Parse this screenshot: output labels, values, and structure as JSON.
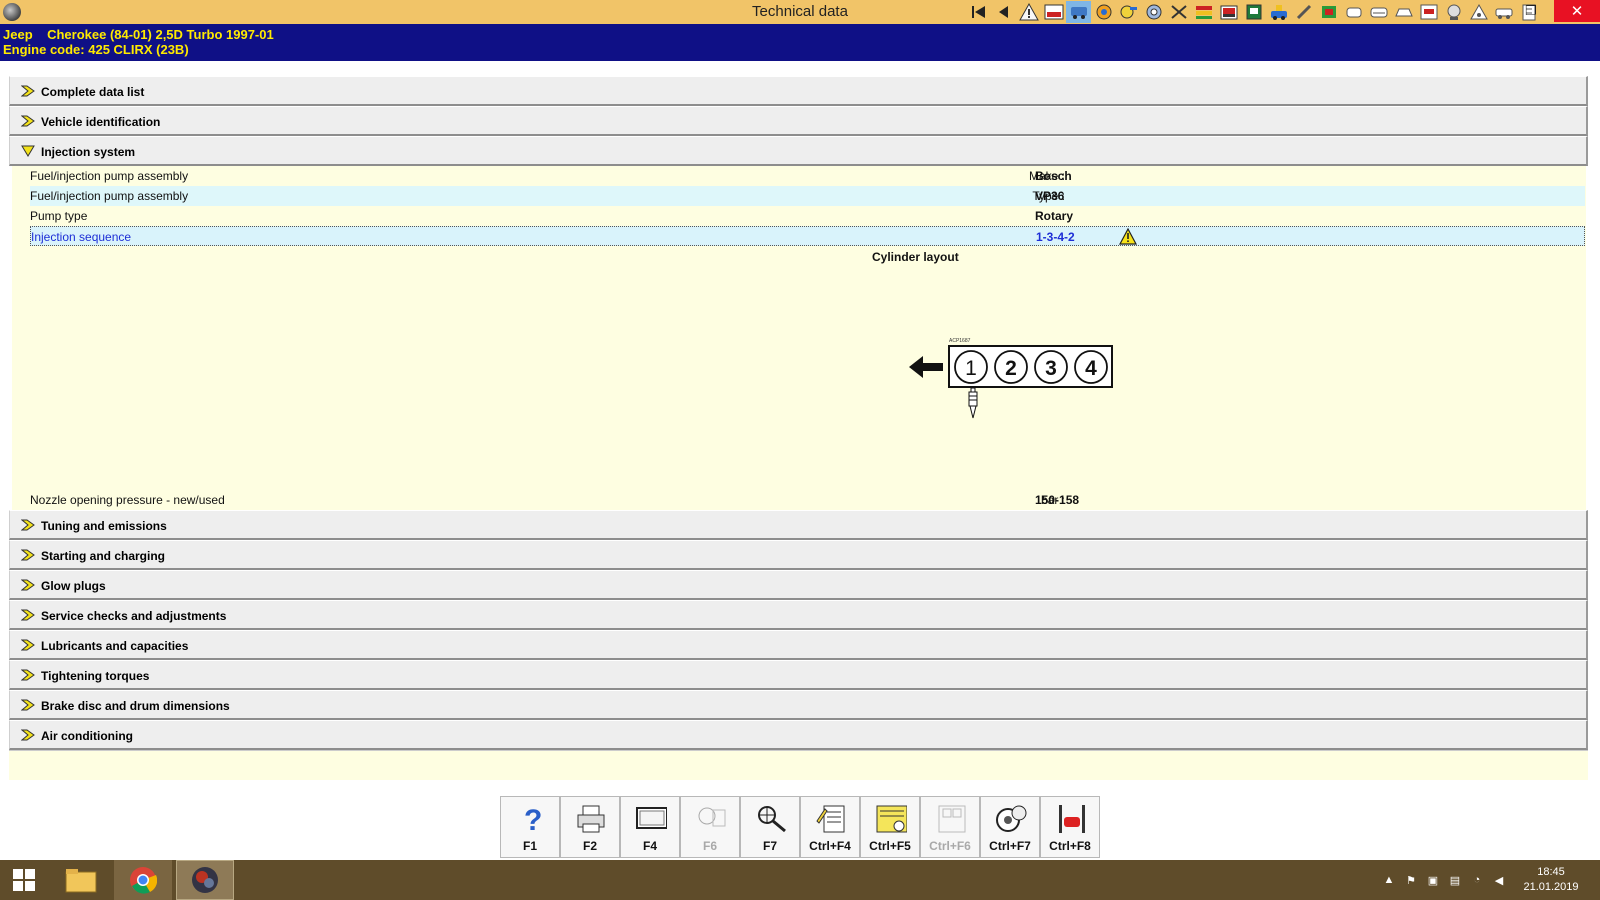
{
  "window": {
    "title": "Technical data",
    "restore_label": "❐",
    "close_label": "✕"
  },
  "toolbar": {
    "icons": [
      "first-page-icon",
      "back-icon",
      "warning-icon",
      "car-lift-icon",
      "car-color-icon",
      "engine-icon",
      "wrench-icon",
      "gauge-icon",
      "tools-icon",
      "battery-icon",
      "car-front-icon",
      "service-icon",
      "car-diagnose-icon",
      "chip-icon",
      "brake-icon",
      "tire-icon",
      "car-outline-icon",
      "spanner-icon",
      "lift-icon",
      "steering-icon",
      "triangle-icon",
      "car-side-icon",
      "clipboard-icon"
    ]
  },
  "vehicle": {
    "line1": "Jeep    Cherokee (84-01) 2,5D Turbo 1997-01",
    "line2": "Engine code: 425 CLIRX (23B)"
  },
  "sections": {
    "complete_data_list": "Complete data list",
    "vehicle_identification": "Vehicle identification",
    "injection_system": "Injection system",
    "tuning": "Tuning and emissions",
    "starting": "Starting and charging",
    "glow_plugs": "Glow plugs",
    "service_checks": "Service checks and adjustments",
    "lubricants": "Lubricants and capacities",
    "torques": "Tightening torques",
    "brake": "Brake disc and drum dimensions",
    "aircon": "Air conditioning"
  },
  "injection": {
    "rows": [
      {
        "name": "Fuel/injection pump assembly",
        "unit": "Make :",
        "value": "Bosch"
      },
      {
        "name": "Fuel/injection pump assembly",
        "unit": "Type :",
        "value": "VP36"
      },
      {
        "name": "Pump type",
        "unit": ":",
        "value": "Rotary"
      },
      {
        "name": "Injection sequence",
        "unit": ":",
        "value": "1-3-4-2"
      }
    ],
    "cylinder_layout_title": "Cylinder layout",
    "diagram_code": "ACP1687",
    "cylinders": [
      "1",
      "2",
      "3",
      "4"
    ],
    "nozzle": {
      "name": "Nozzle opening pressure - new/used",
      "unit": "bar :",
      "value": "150-158"
    }
  },
  "fkeys": [
    {
      "key": "F1",
      "icon": "help-icon",
      "enabled": true
    },
    {
      "key": "F2",
      "icon": "print-icon",
      "enabled": true
    },
    {
      "key": "F4",
      "icon": "monitor-icon",
      "enabled": true
    },
    {
      "key": "F6",
      "icon": "language-icon",
      "enabled": false
    },
    {
      "key": "F7",
      "icon": "search-icon",
      "enabled": true
    },
    {
      "key": "Ctrl+F4",
      "icon": "notes-icon",
      "enabled": true
    },
    {
      "key": "Ctrl+F5",
      "icon": "calculator-icon",
      "enabled": true
    },
    {
      "key": "Ctrl+F6",
      "icon": "calendar-icon",
      "enabled": false
    },
    {
      "key": "Ctrl+F7",
      "icon": "wheel-icon",
      "enabled": true
    },
    {
      "key": "Ctrl+F8",
      "icon": "lift-icon",
      "enabled": true
    }
  ],
  "taskbar": {
    "time": "18:45",
    "date": "21.01.2019"
  },
  "colors": {
    "titlebar": "#f1c468",
    "vehicle_bar": "#0f1086",
    "vehicle_text": "#ffea00",
    "detail_bg": "#fefee1",
    "selected_text": "#1d2ed6",
    "taskbar": "#5f4c2a"
  }
}
